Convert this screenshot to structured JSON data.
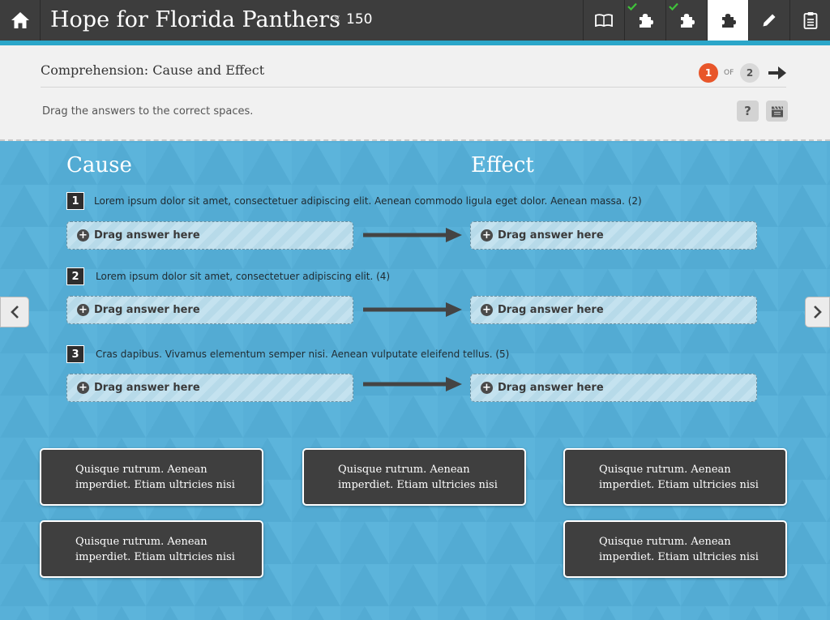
{
  "app": {
    "title": "Hope for Florida Panthers",
    "points_prefix": "×",
    "points": "150"
  },
  "toolbar": {
    "home_icon": "home-icon",
    "tools": [
      {
        "icon": "book-icon",
        "completed": false,
        "active": false
      },
      {
        "icon": "puzzle-icon",
        "completed": true,
        "active": false
      },
      {
        "icon": "puzzle-icon",
        "completed": true,
        "active": false
      },
      {
        "icon": "puzzle-icon",
        "completed": false,
        "active": true
      },
      {
        "icon": "pencil-icon",
        "completed": false,
        "active": false
      },
      {
        "icon": "clipboard-icon",
        "completed": false,
        "active": false
      }
    ]
  },
  "header": {
    "section_title": "Comprehension: Cause and Effect",
    "instructions": "Drag the answers to the correct spaces.",
    "pagination": {
      "current": "1",
      "of_label": "OF",
      "total": "2"
    },
    "help_label": "?"
  },
  "activity": {
    "cause_heading": "Cause",
    "effect_heading": "Effect",
    "drop_label": "Drag answer here",
    "questions": [
      {
        "number": "1",
        "text": "Lorem ipsum dolor sit amet, consectetuer adipiscing elit. Aenean commodo ligula eget dolor. Aenean massa. (2)"
      },
      {
        "number": "2",
        "text": "Lorem ipsum dolor sit amet, consectetuer adipiscing elit. (4)"
      },
      {
        "number": "3",
        "text": "Cras dapibus. Vivamus elementum semper nisi. Aenean vulputate eleifend tellus. (5)"
      }
    ],
    "answers": [
      "Quisque rutrum. Aenean\nimperdiet. Etiam ultricies nisi",
      "Quisque rutrum. Aenean\nimperdiet. Etiam ultricies nisi",
      "Quisque rutrum. Aenean\nimperdiet. Etiam ultricies nisi",
      "Quisque rutrum. Aenean\nimperdiet. Etiam ultricies nisi",
      "Quisque rutrum. Aenean\nimperdiet. Etiam ultricies nisi"
    ]
  },
  "colors": {
    "topbar": "#3d3d3d",
    "accent": "#2ba6c9",
    "background": "#58b0d8",
    "page_badge": "#e8562a",
    "check": "#3fc23a",
    "card": "#3f3f3f"
  }
}
